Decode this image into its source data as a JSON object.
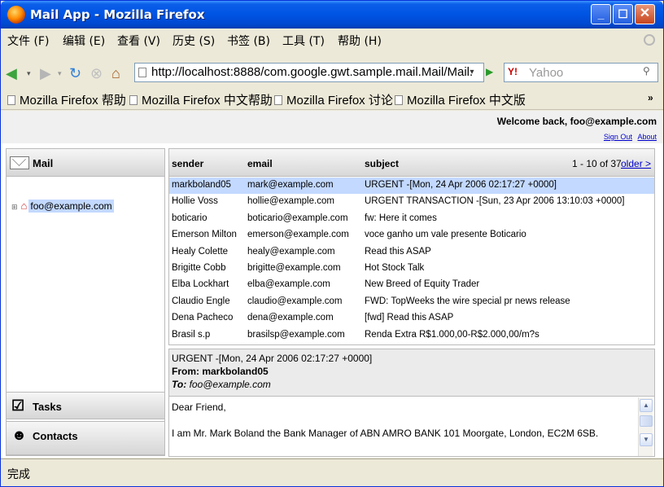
{
  "window": {
    "title": "Mail App - Mozilla Firefox"
  },
  "menu": {
    "items": [
      "文件 (F)",
      "编辑 (E)",
      "查看 (V)",
      "历史 (S)",
      "书签 (B)",
      "工具 (T)",
      "帮助 (H)"
    ]
  },
  "navbar": {
    "url": "http://localhost:8888/com.google.gwt.sample.mail.Mail/Mail.",
    "search_placeholder": "Yahoo",
    "search_engine_logo": "Y!"
  },
  "bookmarks": {
    "items": [
      "Mozilla Firefox 帮助",
      "Mozilla Firefox 中文帮助",
      "Mozilla Firefox 讨论",
      "Mozilla Firefox 中文版"
    ],
    "more": "»"
  },
  "app": {
    "welcome": "Welcome back, foo@example.com",
    "sign_out": "Sign Out",
    "about": "About"
  },
  "stack": {
    "mail_label": "Mail",
    "tasks_label": "Tasks",
    "contacts_label": "Contacts",
    "tree_root": "foo@example.com"
  },
  "mail_list": {
    "columns": {
      "sender": "sender",
      "email": "email",
      "subject": "subject"
    },
    "nav_count": "1 - 10 of 37",
    "older": "older >",
    "rows": [
      {
        "sender": "markboland05",
        "email": "mark@example.com",
        "subject": "URGENT -[Mon, 24 Apr 2006 02:17:27 +0000]"
      },
      {
        "sender": "Hollie Voss",
        "email": "hollie@example.com",
        "subject": "URGENT TRANSACTION -[Sun, 23 Apr 2006 13:10:03 +0000]"
      },
      {
        "sender": "boticario",
        "email": "boticario@example.com",
        "subject": "fw: Here it comes"
      },
      {
        "sender": "Emerson Milton",
        "email": "emerson@example.com",
        "subject": "voce ganho um vale presente Boticario"
      },
      {
        "sender": "Healy Colette",
        "email": "healy@example.com",
        "subject": "Read this ASAP"
      },
      {
        "sender": "Brigitte Cobb",
        "email": "brigitte@example.com",
        "subject": "Hot Stock Talk"
      },
      {
        "sender": "Elba Lockhart",
        "email": "elba@example.com",
        "subject": "New Breed of Equity Trader"
      },
      {
        "sender": "Claudio Engle",
        "email": "claudio@example.com",
        "subject": "FWD: TopWeeks the wire special pr news release"
      },
      {
        "sender": "Dena Pacheco",
        "email": "dena@example.com",
        "subject": "[fwd] Read this ASAP"
      },
      {
        "sender": "Brasil s.p",
        "email": "brasilsp@example.com",
        "subject": "Renda Extra R$1.000,00-R$2.000,00/m?s"
      }
    ]
  },
  "detail": {
    "subject": "URGENT -[Mon, 24 Apr 2006 02:17:27 +0000]",
    "from": "From: markboland05",
    "to_label": "To:",
    "to": "foo@example.com",
    "body": [
      "Dear Friend,",
      "I am Mr. Mark Boland the Bank Manager of ABN AMRO BANK 101 Moorgate, London, EC2M 6SB."
    ]
  },
  "status": {
    "text": "完成"
  }
}
